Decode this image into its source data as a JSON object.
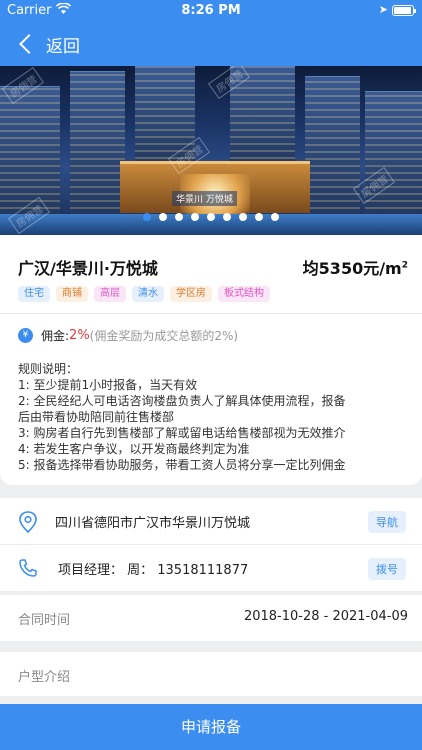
{
  "status_bar": {
    "carrier": "Carrier",
    "time": "8:26 PM"
  },
  "nav": {
    "back_label": "返回"
  },
  "banner": {
    "sign_text": "华景川 万悦城",
    "watermark": "房佣营",
    "dot_count": 9,
    "active_dot": 0
  },
  "property": {
    "title": "广汉/华景川·万悦城",
    "price": "均5350元/m",
    "price_unit_sup": "2",
    "tags": [
      {
        "label": "住宅",
        "color": "#3b8ef0",
        "bg": "#e6f0fd"
      },
      {
        "label": "商铺",
        "color": "#e07b2a",
        "bg": "#fdefe2"
      },
      {
        "label": "高层",
        "color": "#e255c5",
        "bg": "#fbe6f7"
      },
      {
        "label": "清水",
        "color": "#3b8ef0",
        "bg": "#e6f0fd"
      },
      {
        "label": "学区房",
        "color": "#e07b2a",
        "bg": "#fdefe2"
      },
      {
        "label": "板式结构",
        "color": "#e255c5",
        "bg": "#fbe6f7"
      }
    ]
  },
  "commission": {
    "label": "佣金:",
    "value": "2%",
    "note": "(佣金奖励为成交总额的2%)"
  },
  "rules": {
    "heading": "规则说明：",
    "lines": [
      "1:  至少提前1小时报备，当天有效",
      "2:  全民经纪人可电话咨询楼盘负责人了解具体使用流程，报备",
      "后由带看协助陪同前往售楼部",
      "3:  购房者自行先到售楼部了解或留电话给售楼部视为无效推介",
      "4:  若发生客户争议，以开发商最终判定为准",
      "5:  报备选择带看协助服务，带看工资人员将分享一定比列佣金"
    ]
  },
  "address": {
    "text": "四川省德阳市广汉市华景川万悦城",
    "button": "导航"
  },
  "manager": {
    "text": "项目经理：  周：  13518111877",
    "button": "拨号"
  },
  "contract": {
    "label": "合同时间",
    "value": "2018-10-28 - 2021-04-09"
  },
  "layout": {
    "label": "户型介绍"
  },
  "submit": {
    "label": "申请报备"
  },
  "colors": {
    "accent": "#3b8ef0",
    "commission": "#e23a3a"
  }
}
